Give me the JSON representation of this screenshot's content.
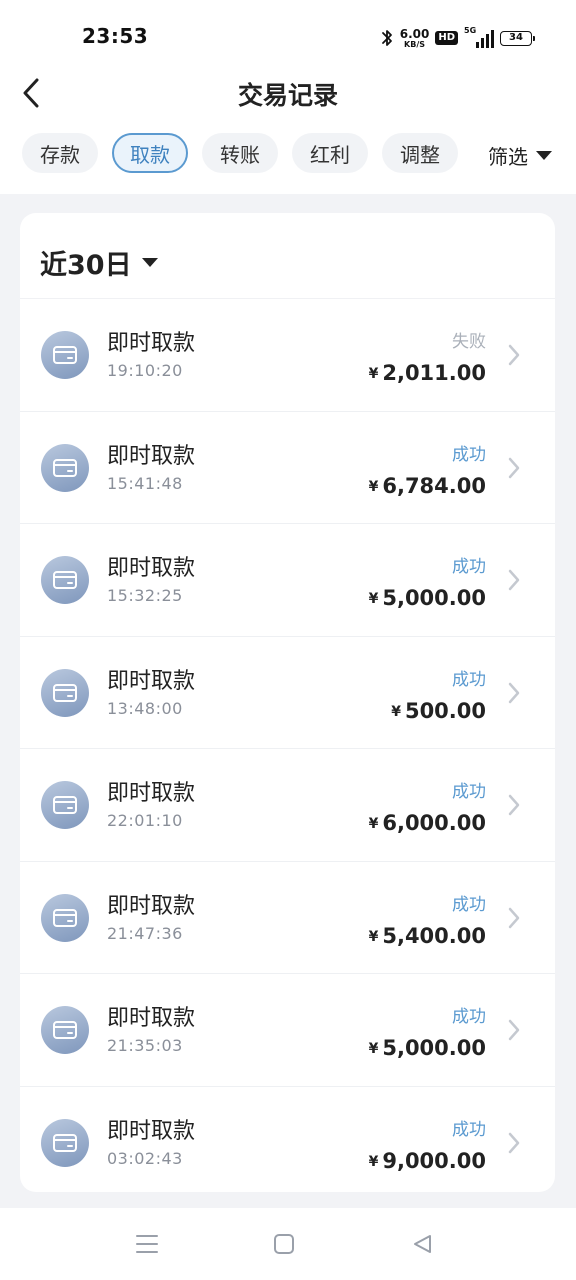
{
  "status_bar": {
    "time": "23:53",
    "net_speed_value": "6.00",
    "net_speed_unit": "KB/S",
    "hd_label": "HD",
    "signal_label": "5G",
    "battery_level": "34",
    "icons": [
      "bluetooth-icon",
      "hd-icon",
      "signal-icon",
      "battery-icon"
    ]
  },
  "header": {
    "title": "交易记录",
    "back_icon": "chevron-left-icon"
  },
  "tabs": [
    {
      "label": "存款",
      "active": false
    },
    {
      "label": "取款",
      "active": true
    },
    {
      "label": "转账",
      "active": false
    },
    {
      "label": "红利",
      "active": false
    },
    {
      "label": "调整",
      "active": false
    }
  ],
  "filter": {
    "label": "筛选",
    "icon": "caret-down-icon"
  },
  "period": {
    "label": "近30日",
    "icon": "caret-down-icon"
  },
  "transactions": [
    {
      "title": "即时取款",
      "time": "19:10:20",
      "status": "失败",
      "currency": "¥",
      "amount": "2,011.00"
    },
    {
      "title": "即时取款",
      "time": "15:41:48",
      "status": "成功",
      "currency": "¥",
      "amount": "6,784.00"
    },
    {
      "title": "即时取款",
      "time": "15:32:25",
      "status": "成功",
      "currency": "¥",
      "amount": "5,000.00"
    },
    {
      "title": "即时取款",
      "time": "13:48:00",
      "status": "成功",
      "currency": "¥",
      "amount": "500.00"
    },
    {
      "title": "即时取款",
      "time": "22:01:10",
      "status": "成功",
      "currency": "¥",
      "amount": "6,000.00"
    },
    {
      "title": "即时取款",
      "time": "21:47:36",
      "status": "成功",
      "currency": "¥",
      "amount": "5,400.00"
    },
    {
      "title": "即时取款",
      "time": "21:35:03",
      "status": "成功",
      "currency": "¥",
      "amount": "5,000.00"
    },
    {
      "title": "即时取款",
      "time": "03:02:43",
      "status": "成功",
      "currency": "¥",
      "amount": "9,000.00"
    }
  ],
  "colors": {
    "accent": "#5b9ad0",
    "failed": "#aab0b9",
    "icon_gradient_start": "#b9c8de",
    "icon_gradient_end": "#7f97bc"
  },
  "nav": {
    "icons": [
      "menu-icon",
      "home-square-icon",
      "back-triangle-icon"
    ]
  }
}
